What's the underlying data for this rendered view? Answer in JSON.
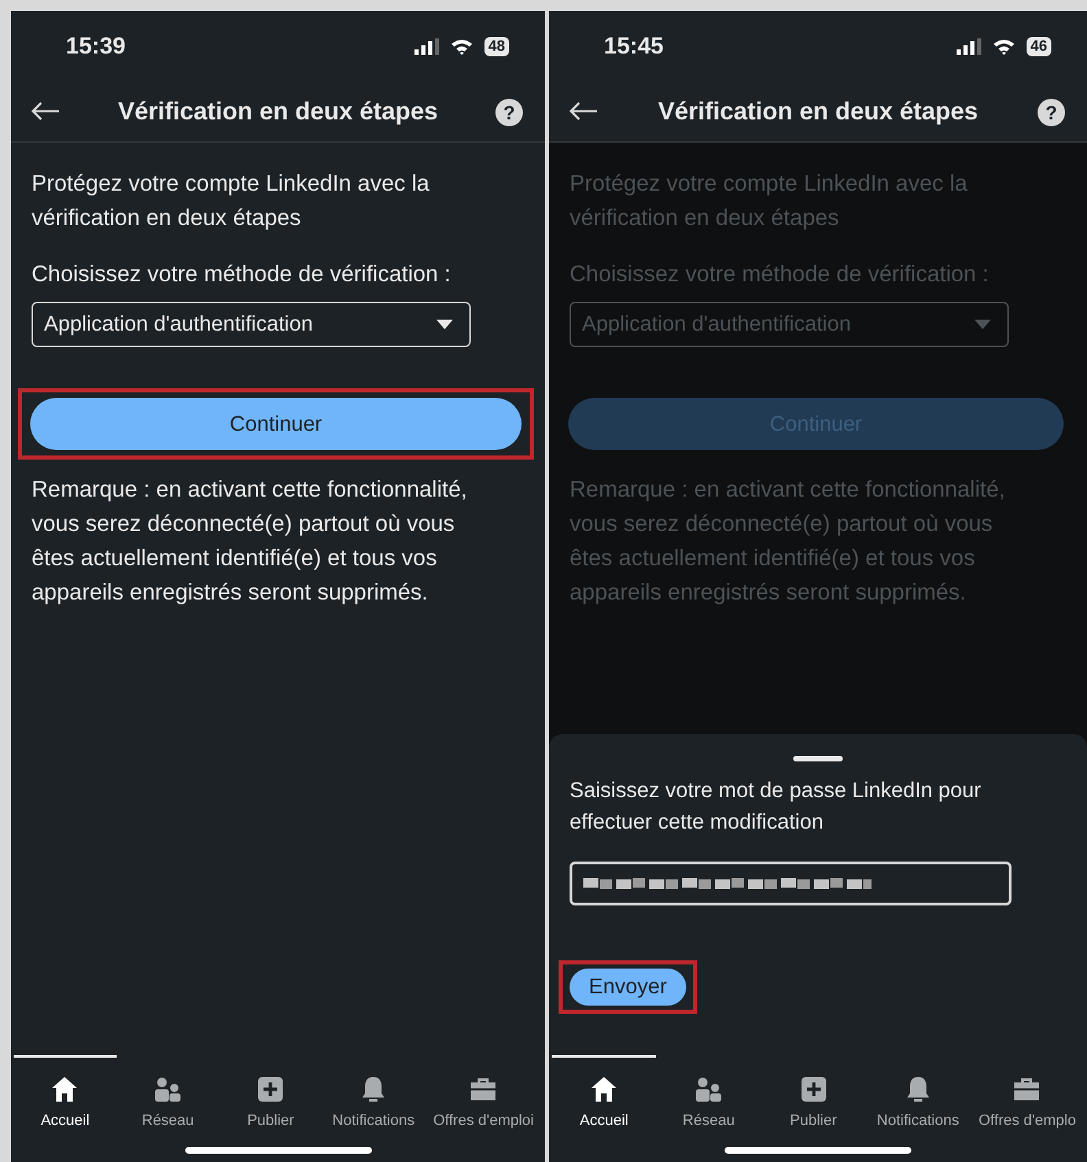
{
  "screens": [
    {
      "time": "15:39",
      "battery": "48",
      "title": "Vérification en deux étapes",
      "help_glyph": "?",
      "dimmed": false,
      "intro": "Protégez votre compte LinkedIn avec la vérification en deux étapes",
      "method_label": "Choisissez votre méthode de vérification :",
      "method_value": "Application d'authentification",
      "continue_button": {
        "label": "Continuer",
        "highlighted": true
      },
      "note": "Remarque : en activant cette fonctionnalité, vous serez déconnecté(e) partout où vous êtes actuellement identifié(e) et tous vos appareils enregistrés seront supprimés.",
      "nav": [
        {
          "label": "Accueil",
          "selected": true
        },
        {
          "label": "Réseau",
          "selected": false
        },
        {
          "label": "Publier",
          "selected": false
        },
        {
          "label": "Notifications",
          "selected": false
        },
        {
          "label": "Offres d'emploi",
          "selected": false
        }
      ]
    },
    {
      "time": "15:45",
      "battery": "46",
      "title": "Vérification en deux étapes",
      "help_glyph": "?",
      "dimmed": true,
      "intro": "Protégez votre compte LinkedIn avec la vérification en deux étapes",
      "method_label": "Choisissez votre méthode de vérification :",
      "method_value": "Application d'authentification",
      "continue_button": {
        "label": "Continuer",
        "highlighted": false
      },
      "note": "Remarque : en activant cette fonctionnalité, vous serez déconnecté(e) partout où vous êtes actuellement identifié(e) et tous vos appareils enregistrés seront supprimés.",
      "sheet": {
        "prompt": "Saisissez votre mot de passe LinkedIn pour effectuer cette modification",
        "submit_button": {
          "label": "Envoyer",
          "highlighted": true
        }
      },
      "nav": [
        {
          "label": "Accueil",
          "selected": true
        },
        {
          "label": "Réseau",
          "selected": false
        },
        {
          "label": "Publier",
          "selected": false
        },
        {
          "label": "Notifications",
          "selected": false
        },
        {
          "label": "Offres d'emplo",
          "selected": false
        }
      ]
    }
  ]
}
